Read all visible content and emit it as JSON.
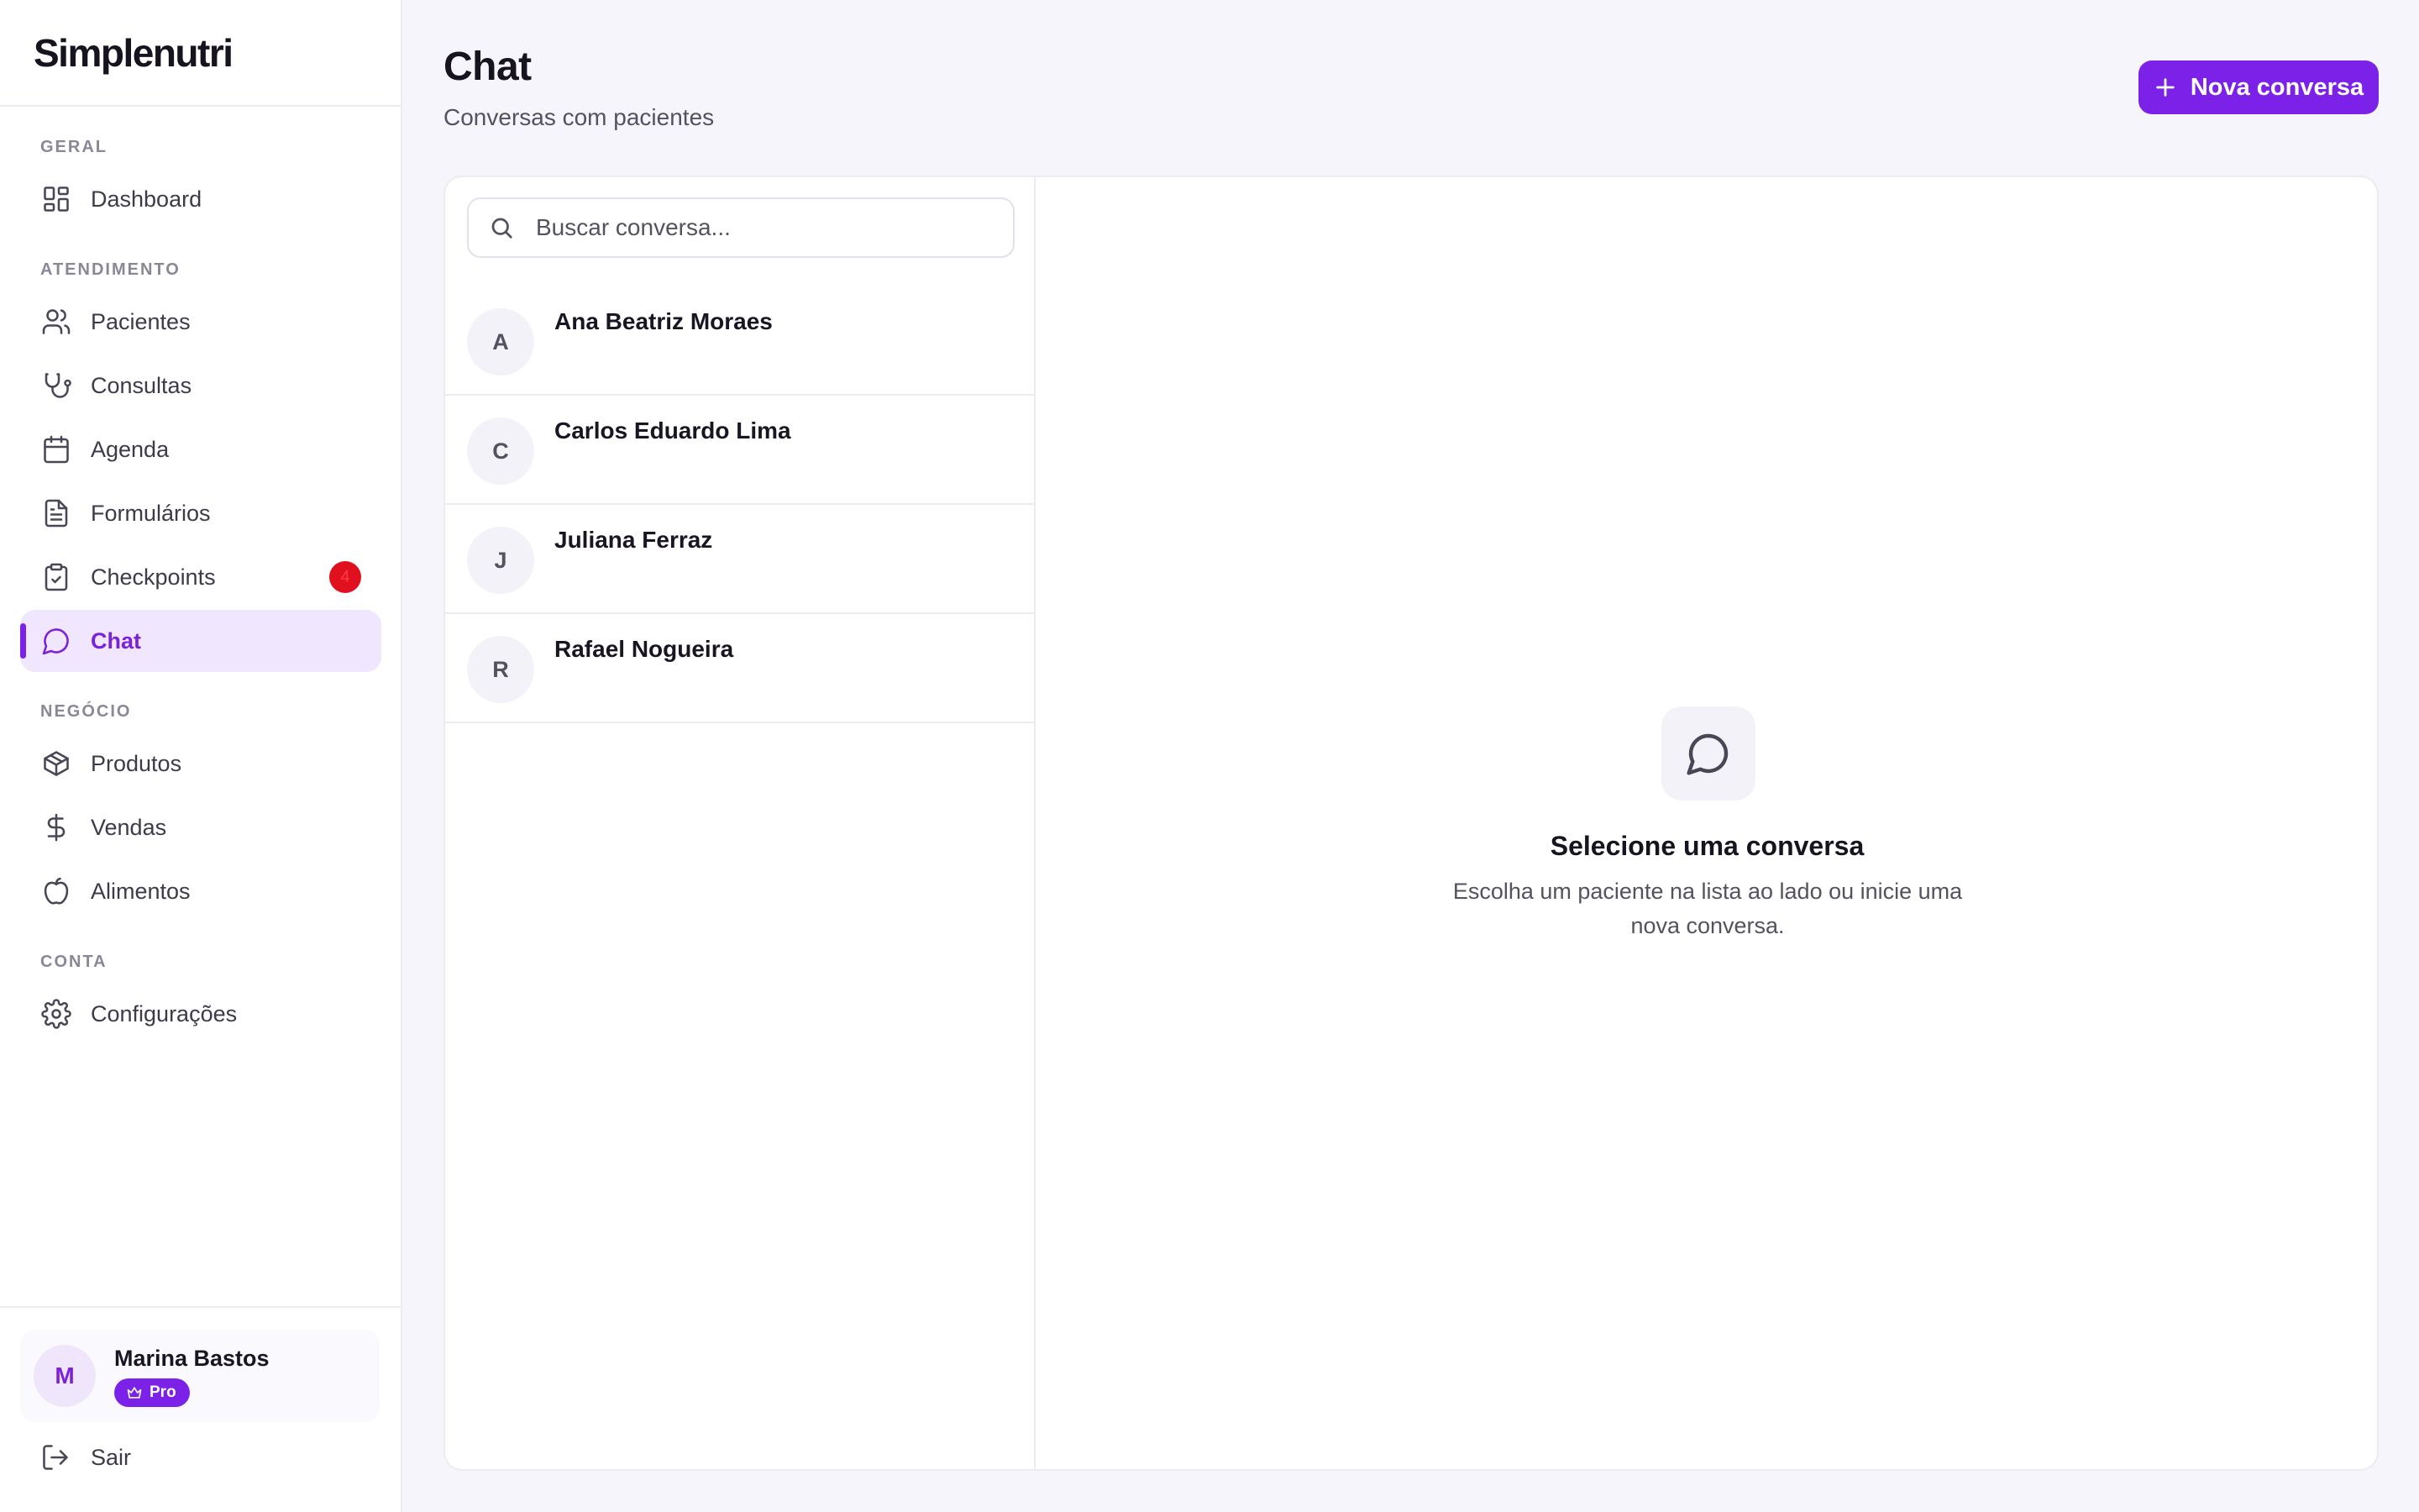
{
  "brand": {
    "logo": "Simplenutri",
    "accent": "#7c22e8"
  },
  "sidebar": {
    "sections": {
      "geral": "GERAL",
      "atendimento": "ATENDIMENTO",
      "negocio": "NEGÓCIO",
      "conta": "CONTA"
    },
    "items": {
      "dashboard": "Dashboard",
      "pacientes": "Pacientes",
      "consultas": "Consultas",
      "agenda": "Agenda",
      "formularios": "Formulários",
      "checkpoints": "Checkpoints",
      "chat": "Chat",
      "produtos": "Produtos",
      "vendas": "Vendas",
      "alimentos": "Alimentos",
      "configuracoes": "Configurações"
    },
    "checkpoints_badge": "4",
    "active_item": "Chat",
    "user": {
      "initial": "M",
      "name": "Marina Bastos",
      "plan": "Pro"
    },
    "logout": "Sair"
  },
  "header": {
    "title": "Chat",
    "subtitle": "Conversas com pacientes",
    "new_button": "Nova conversa"
  },
  "search": {
    "placeholder": "Buscar conversa..."
  },
  "conversations": [
    {
      "initial": "A",
      "name": "Ana Beatriz Moraes"
    },
    {
      "initial": "C",
      "name": "Carlos Eduardo Lima"
    },
    {
      "initial": "J",
      "name": "Juliana Ferraz"
    },
    {
      "initial": "R",
      "name": "Rafael Nogueira"
    }
  ],
  "empty_state": {
    "icon": "message-circle-icon",
    "title": "Selecione uma conversa",
    "description": "Escolha um paciente na lista ao lado ou inicie uma nova conversa."
  }
}
